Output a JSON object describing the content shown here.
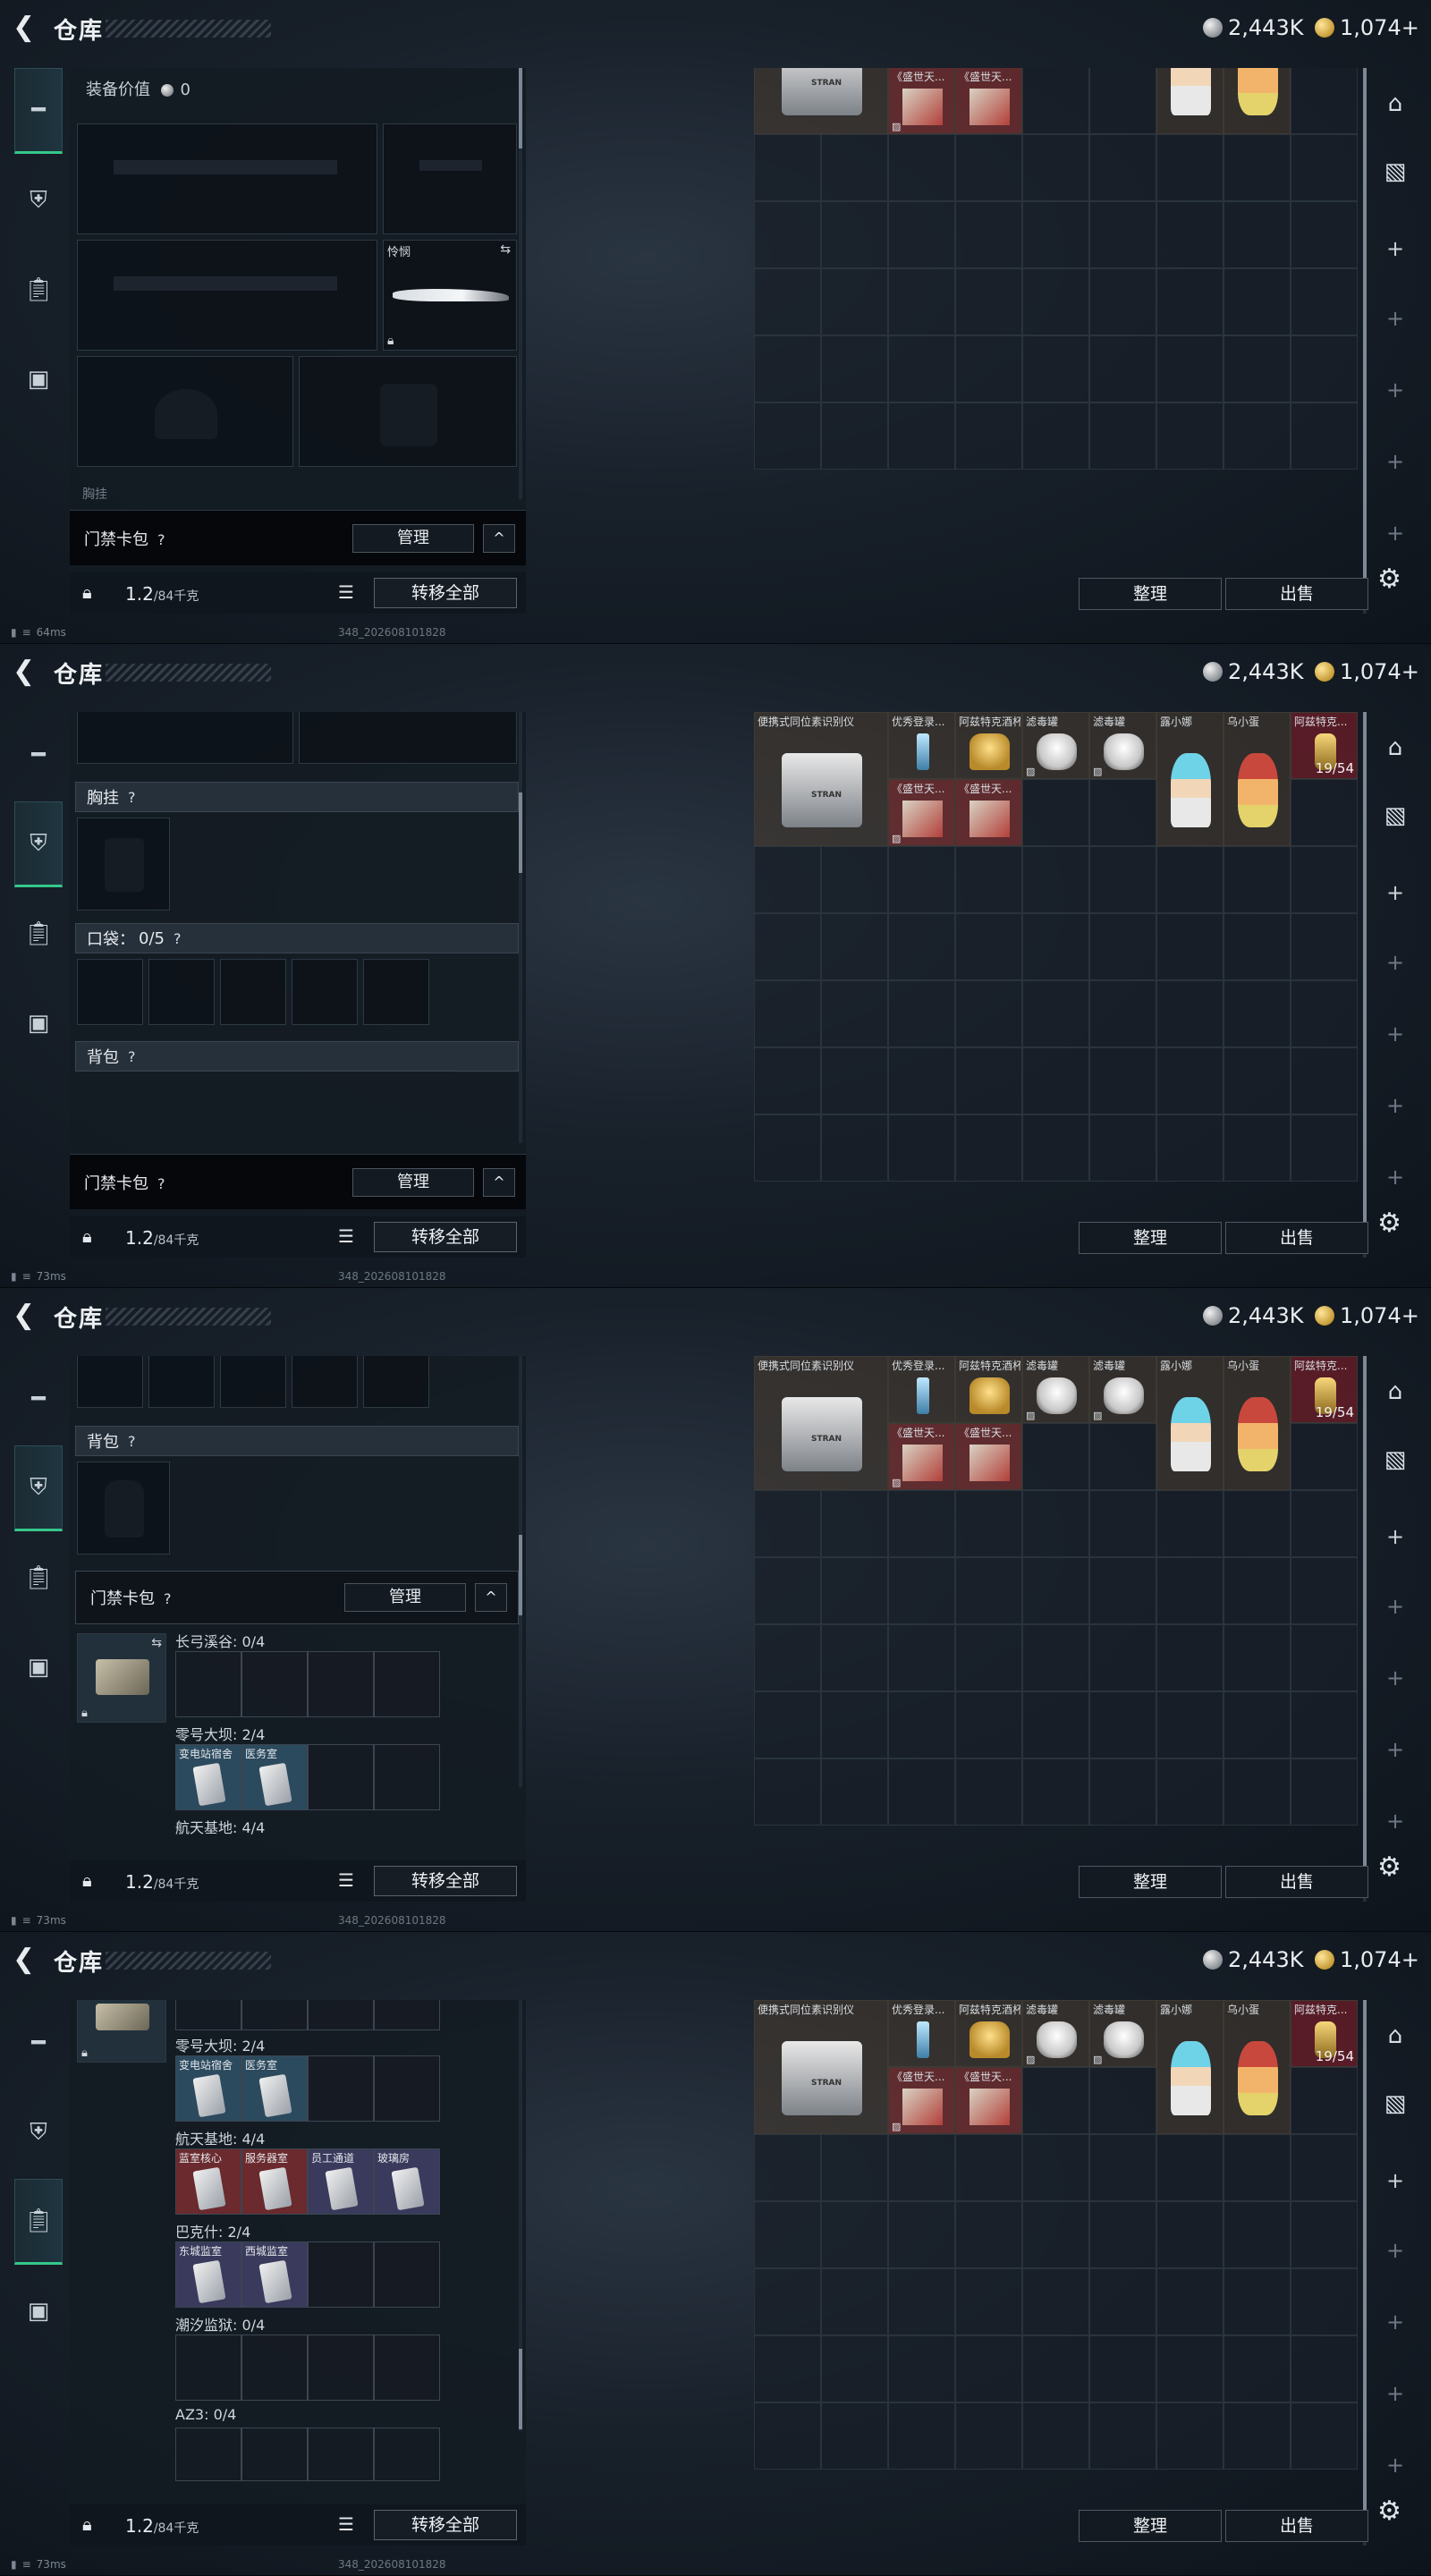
{
  "header": {
    "title": "仓库",
    "silver": "2,443K",
    "gold": "1,074",
    "gold_plus": "+"
  },
  "equipment": {
    "value_label": "装备价值",
    "value": "0",
    "melee_label": "怜悯",
    "chest_label": "胸挂",
    "pocket_label": "口袋：",
    "pocket_count": "0/5",
    "backpack_label": "背包",
    "help": "?"
  },
  "card_pack": {
    "label": "门禁卡包",
    "manage": "管理",
    "collapse": "^",
    "rows": [
      {
        "name": "长弓溪谷:",
        "count": "0/4"
      },
      {
        "name": "零号大坝:",
        "count": "2/4",
        "cards": [
          "变电站宿舍",
          "医务室"
        ]
      },
      {
        "name": "航天基地:",
        "count": "4/4",
        "cards": [
          "蓝室核心",
          "服务器室",
          "员工通道",
          "玻璃房"
        ]
      },
      {
        "name": "巴克什:",
        "count": "2/4",
        "cards": [
          "东城监室",
          "西城监室"
        ]
      },
      {
        "name": "潮汐监狱:",
        "count": "0/4"
      },
      {
        "name": "AZ3:",
        "count": "0/4"
      }
    ]
  },
  "bottom": {
    "weight": "1.2",
    "weight_max": "/84千克",
    "transfer_all": "转移全部"
  },
  "storage": {
    "items": [
      {
        "name": "便携式同位素识别仪",
        "tag": "STRAN"
      },
      {
        "name": "优秀登录..."
      },
      {
        "name": "阿兹特克酒杯"
      },
      {
        "name": "滤毒罐"
      },
      {
        "name": "滤毒罐"
      },
      {
        "name": "露小娜"
      },
      {
        "name": "乌小蛋"
      },
      {
        "name": "阿兹特克...",
        "count": "19/54"
      },
      {
        "name": "《盛世天..."
      },
      {
        "name": "《盛世天..."
      }
    ],
    "sort": "整理",
    "sell": "出售"
  },
  "status": {
    "ping_1": "64ms",
    "ping_2": "73ms",
    "ping_3": "73ms",
    "ping_4": "73ms",
    "build": "348_202608101828"
  }
}
